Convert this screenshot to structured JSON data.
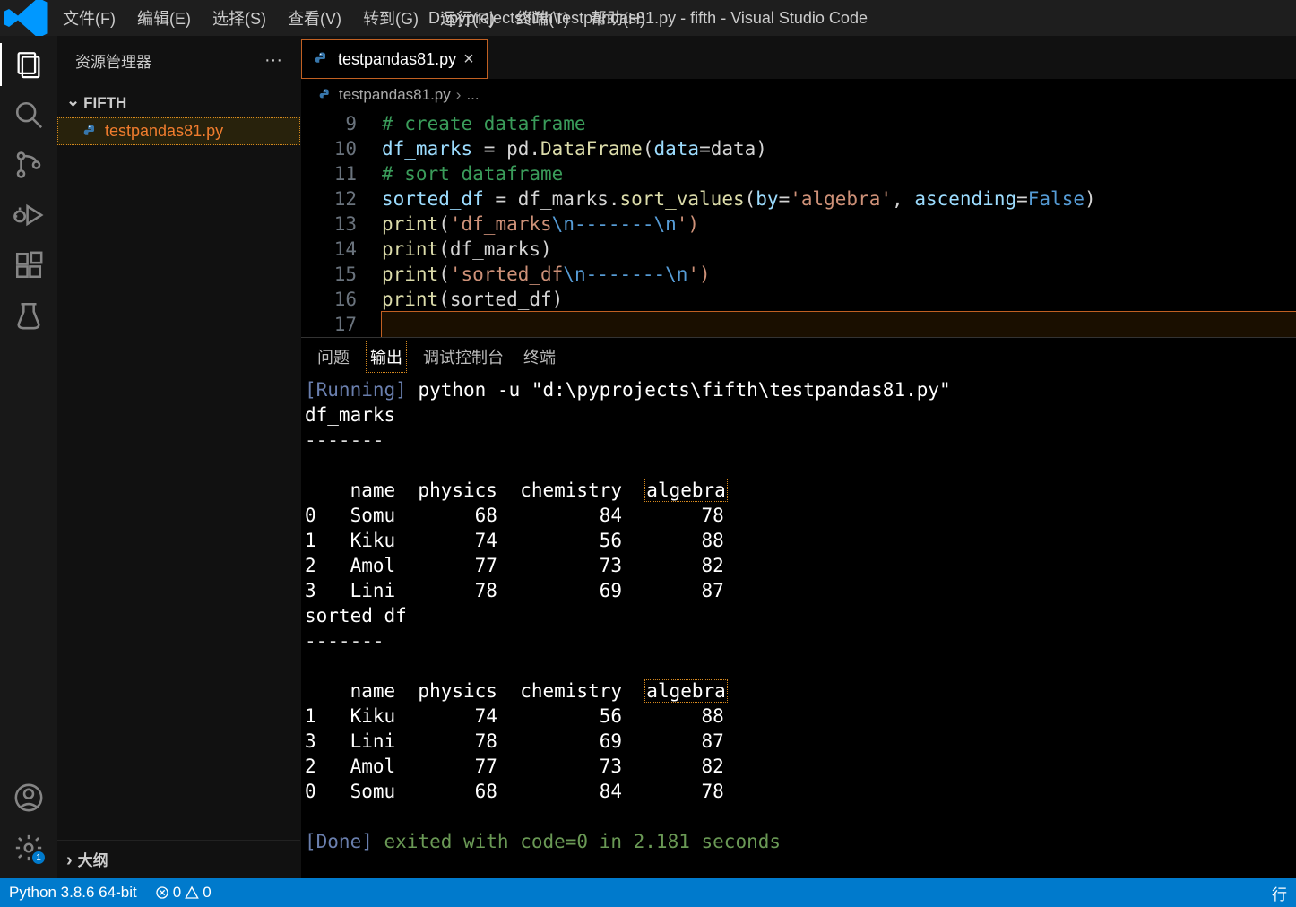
{
  "window": {
    "title": "D:\\pyprojects\\fifth\\testpandas81.py - fifth - Visual Studio Code"
  },
  "menu": {
    "file": "文件(F)",
    "edit": "编辑(E)",
    "select": "选择(S)",
    "view": "查看(V)",
    "go": "转到(G)",
    "run": "运行(R)",
    "terminal": "终端(T)",
    "help": "帮助(H)"
  },
  "sidebar": {
    "explorer_title": "资源管理器",
    "folder_name": "FIFTH",
    "file": "testpandas81.py",
    "outline": "大纲"
  },
  "tab": {
    "file": "testpandas81.py"
  },
  "breadcrumb": {
    "file": "testpandas81.py",
    "more": "..."
  },
  "code": {
    "lines": {
      "9": "# create dataframe",
      "10a": "df_marks ",
      "10b": "=",
      "10c": " pd.",
      "10d": "DataFrame",
      "10e": "(",
      "10f": "data",
      "10g": "=data)",
      "11": "# sort dataframe",
      "12a": "sorted_df ",
      "12b": "=",
      "12c": " df_marks.",
      "12d": "sort_values",
      "12e": "(",
      "12f": "by",
      "12g": "=",
      "12h": "'algebra'",
      "12i": ", ",
      "12j": "ascending",
      "12k": "=",
      "12l": "False",
      "12m": ")",
      "13a": "print",
      "13b": "(",
      "13c": "'df_marks",
      "13d": "\\n-------\\n",
      "13e": "')",
      "14a": "print",
      "14b": "(df_marks)",
      "15a": "print",
      "15b": "(",
      "15c": "'sorted_df",
      "15d": "\\n-------\\n",
      "15e": "')",
      "16a": "print",
      "16b": "(sorted_df)"
    }
  },
  "panel": {
    "problems": "问题",
    "output": "输出",
    "debug": "调试控制台",
    "terminal": "终端"
  },
  "output": {
    "running_bracket": "[Running]",
    "running_cmd": " python -u \"d:\\pyprojects\\fifth\\testpandas81.py\"",
    "df_label": "df_marks",
    "rule": "-------",
    "hdr": "    name  physics  chemistry  ",
    "hdr_alg": "algebra",
    "t1": [
      "0   Somu       68         84       78",
      "1   Kiku       74         56       88",
      "2   Amol       77         73       82",
      "3   Lini       78         69       87"
    ],
    "sorted_label": "sorted_df",
    "t2": [
      "1   Kiku       74         56       88",
      "3   Lini       78         69       87",
      "2   Amol       77         73       82",
      "0   Somu       68         84       78"
    ],
    "done_bracket": "[Done]",
    "done_tail": " exited with code=0 in 2.181 seconds"
  },
  "status": {
    "python": "Python 3.8.6 64-bit",
    "errors": "0",
    "warnings": "0",
    "lineprefix": "行 "
  },
  "gear_badge": "1"
}
